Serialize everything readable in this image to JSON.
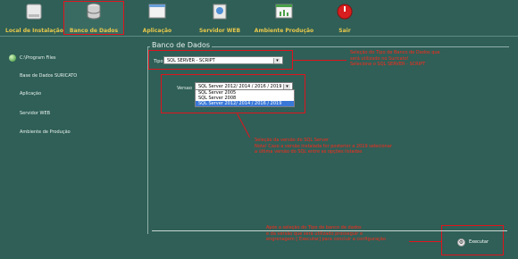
{
  "toolbar": {
    "items": [
      {
        "label": "Local de Instalação",
        "icon": "drive-icon"
      },
      {
        "label": "Banco de Dados",
        "icon": "database-icon"
      },
      {
        "label": "Aplicação",
        "icon": "window-icon"
      },
      {
        "label": "Servidor WEB",
        "icon": "server-icon"
      },
      {
        "label": "Ambiente Produção",
        "icon": "chart-window-icon"
      },
      {
        "label": "Sair",
        "icon": "exit-icon"
      }
    ]
  },
  "sidebar": {
    "items": [
      {
        "label": "C:\\Program Files"
      },
      {
        "label": "Base de Dados SURICATO"
      },
      {
        "label": "Aplicação"
      },
      {
        "label": "Servidor WEB"
      },
      {
        "label": "Ambiente de Produção"
      }
    ]
  },
  "main": {
    "group_title": "Banco de Dados",
    "tipo_label": "Tipo",
    "tipo_value": "SQL SERVER - SCRIPT",
    "versao_label": "Versao",
    "versao_value": "SQL Server 2012/ 2014 / 2016 / 2019",
    "versao_options": [
      "SQL Server 2005",
      "SQL Server 2008",
      "SQL Server 2012/ 2014 / 2016 / 2019"
    ],
    "execute_label": "Executar"
  },
  "annotations": {
    "tipo_note": [
      "Seleção do Tipo de Banco de Dados que",
      "será utilizado no Suricato!",
      "Selecione o SQL SERVER - SCRIPT"
    ],
    "versao_note": [
      "Seleção da versão do SQL Server",
      "Nota! Caso a versão instalada for posterior a 2019 selecionar",
      "a última versão do SQL entre as opções listadas"
    ],
    "execute_note": [
      "Após a seleção do Tipo de banco de dados",
      "e da versão que será utilizado prosseguir e",
      "engrenagem [ Executar] para concluir a configuração"
    ]
  },
  "colors": {
    "background": "#2f5f57",
    "highlight": "#e0141c",
    "accent_label": "#e8c84a",
    "selection": "#3a78d8"
  }
}
